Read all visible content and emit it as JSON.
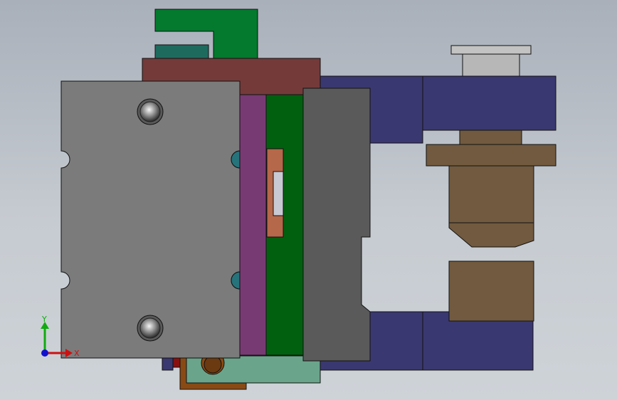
{
  "triad": {
    "x_label": "X",
    "y_label": "Y"
  },
  "colors": {
    "green_bracket": "#047a2e",
    "teal_small_block": "#1e6b5e",
    "maroon_plate": "#743a3a",
    "gray_front_plate": "#7b7b7b",
    "dark_gray_plate": "#5a5a5a",
    "purple_strip": "#773a73",
    "green_plate": "#00600f",
    "orange_insert": "#b6684a",
    "navy_block": "#3a3870",
    "brown_piston": "#715a3f",
    "light_gray_cap": "#c3c3c3",
    "mint_plate": "#6aa58b",
    "teal_notch": "#27737b",
    "axis_x": "#cc1111",
    "axis_y": "#11aa11",
    "axis_origin": "#1111cc"
  }
}
